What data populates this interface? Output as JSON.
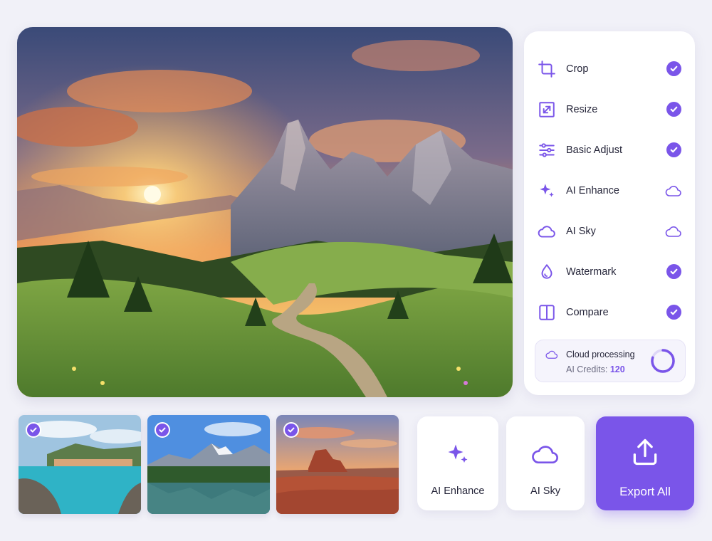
{
  "colors": {
    "accent": "#7a55e9",
    "panel": "#ffffff",
    "background": "#f1f1f8"
  },
  "tools": [
    {
      "label": "Crop",
      "icon": "crop-icon",
      "status": "done"
    },
    {
      "label": "Resize",
      "icon": "resize-icon",
      "status": "done"
    },
    {
      "label": "Basic Adjust",
      "icon": "sliders-icon",
      "status": "done"
    },
    {
      "label": "AI Enhance",
      "icon": "sparkle-icon",
      "status": "cloud"
    },
    {
      "label": "AI Sky",
      "icon": "cloud-icon",
      "status": "cloud"
    },
    {
      "label": "Watermark",
      "icon": "droplet-icon",
      "status": "done"
    },
    {
      "label": "Compare",
      "icon": "compare-icon",
      "status": "done"
    }
  ],
  "cloud_processing": {
    "title": "Cloud processing",
    "credits_label": "AI Credits:",
    "credits_value": "120",
    "progress": 0.8
  },
  "thumbnails": [
    {
      "subject": "coastal-village",
      "selected": true
    },
    {
      "subject": "mountain-lake",
      "selected": true
    },
    {
      "subject": "desert-butte",
      "selected": true
    }
  ],
  "actions": {
    "ai_enhance": "AI Enhance",
    "ai_sky": "AI Sky",
    "export_all": "Export All"
  }
}
